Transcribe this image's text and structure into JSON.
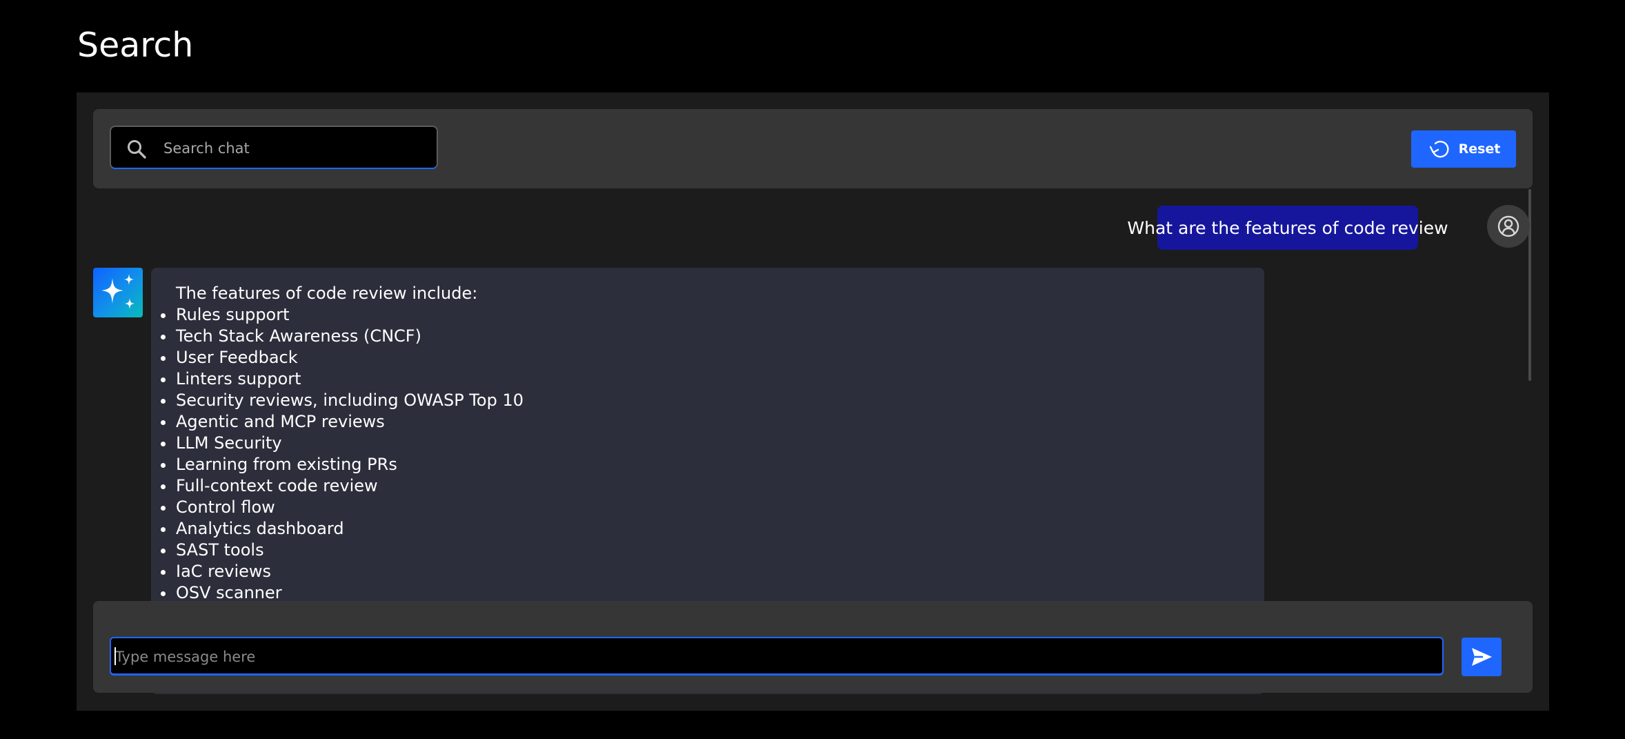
{
  "page": {
    "title": "Search"
  },
  "toolbar": {
    "search_placeholder": "Search chat",
    "search_value": "",
    "search_icon": "search-icon",
    "reset_label": "Reset",
    "reset_icon": "reset-icon"
  },
  "conversation": {
    "user_message": "What are the features of code review",
    "user_avatar_icon": "user-avatar-icon",
    "ai_avatar_icon": "sparkle-icon",
    "ai_intro": "The features of code review include:",
    "ai_features": [
      "Rules support",
      "Tech Stack Awareness (CNCF)",
      "User Feedback",
      "Linters support",
      "Security reviews, including OWASP Top 10",
      "Agentic and MCP reviews",
      "LLM Security",
      "Learning from existing PRs",
      "Full-context code review",
      "Control flow",
      "Analytics dashboard",
      "SAST tools",
      "IaC reviews",
      "OSV scanner"
    ]
  },
  "composer": {
    "placeholder": "Type message here",
    "value": "",
    "send_icon": "send-icon"
  },
  "colors": {
    "accent": "#1f66ff",
    "user_bubble": "#16169c",
    "ai_bubble": "#2c2e3b",
    "panel": "#1c1c1c",
    "toolbar": "#363636"
  }
}
